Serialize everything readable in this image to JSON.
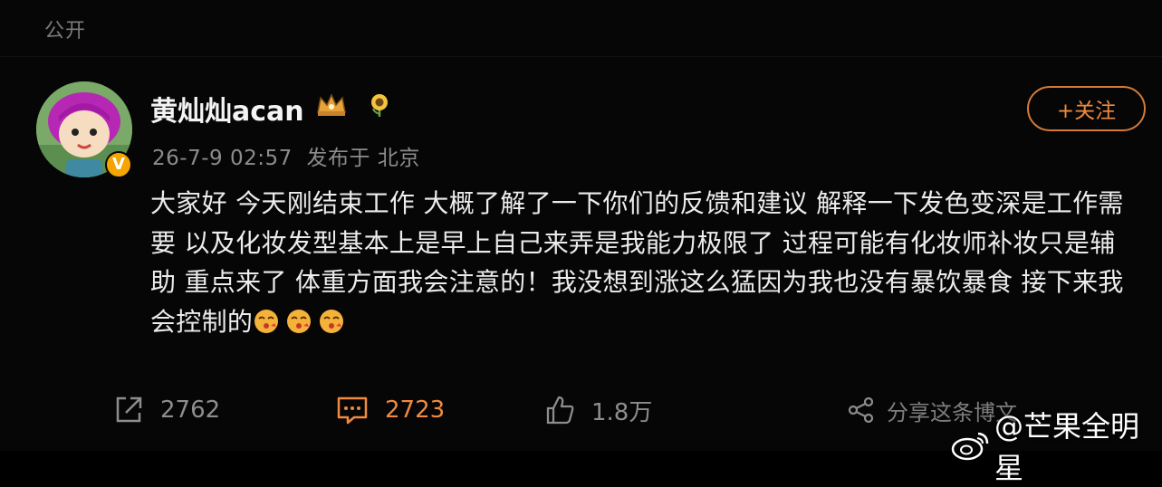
{
  "header": {
    "visibility": "公开"
  },
  "post": {
    "username": "黄灿灿acan",
    "timestamp": "26-7-9 02:57",
    "location": "发布于 北京",
    "follow_label": "+关注",
    "body": "大家好 今天刚结束工作 大概了解了一下你们的反馈和建议 解释一下发色变深是工作需要 以及化妆发型基本上是早上自己来弄是我能力极限了 过程可能有化妆师补妆只是辅助 重点来了 体重方面我会注意的！我没想到涨这么猛因为我也没有暴饮暴食 接下来我会控制的",
    "emoji": [
      "kiss-face-emoji",
      "kiss-face-emoji",
      "kiss-face-emoji"
    ]
  },
  "actions": {
    "repost_count": "2762",
    "comment_count": "2723",
    "like_count": "1.8万",
    "share_label": "分享这条博文"
  },
  "watermark": {
    "text": "@芒果全明星"
  },
  "colors": {
    "background": "#060606",
    "accent": "#f08a3e",
    "muted": "#8c8c8c",
    "verified": "#f5a400"
  }
}
